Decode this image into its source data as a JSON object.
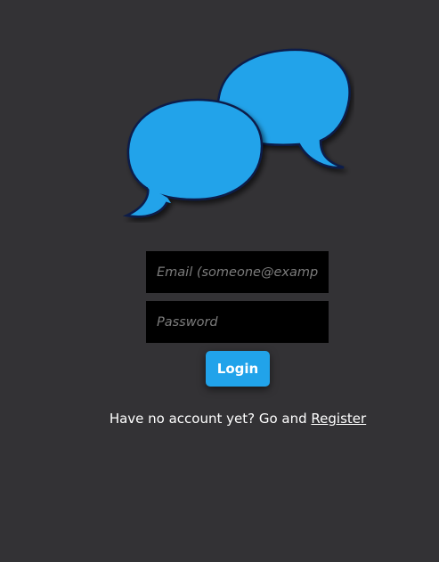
{
  "logo": {
    "icon": "chat-bubbles-icon",
    "bubble_color": "#21a3ea",
    "outline_color": "#0b1e4a"
  },
  "login_form": {
    "email_placeholder": "Email (someone@example.com)",
    "email_value": "",
    "password_placeholder": "Password",
    "password_value": "",
    "login_label": "Login",
    "button_color": "#21a3ea"
  },
  "register": {
    "prompt": "Have no account yet? Go and ",
    "link_label": "Register"
  },
  "colors": {
    "background": "#333235",
    "field_background": "#000000"
  }
}
